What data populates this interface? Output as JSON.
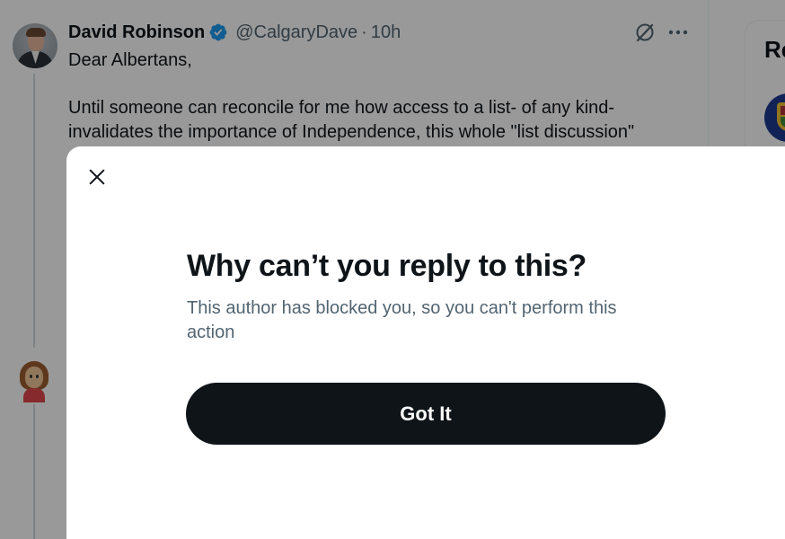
{
  "tweet": {
    "author_name": "David Robinson",
    "author_handle": "@CalgaryDave",
    "separator": "·",
    "timestamp": "10h",
    "body_lines": [
      "Dear Albertans,",
      "Until someone can reconcile for me how access to a list- of any kind- invalidates the importance of Independence, this whole \"list discussion\""
    ],
    "icons": {
      "verified": "verified-badge-icon",
      "grok": "grok-icon",
      "more": "more-icon"
    }
  },
  "sidebar": {
    "heading_partial": "Re"
  },
  "modal": {
    "title": "Why can’t you reply to this?",
    "message": "This author has blocked you, so you can't perform this action",
    "button_label": "Got It",
    "close_icon": "close-icon"
  },
  "colors": {
    "text_primary": "#0f1419",
    "text_secondary": "#536471",
    "verified_blue": "#1d9bf0",
    "button_bg": "#0f1419",
    "backdrop": "rgba(0,0,0,0.4)"
  }
}
